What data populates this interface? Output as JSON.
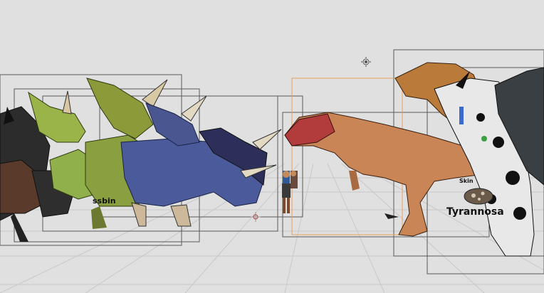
{
  "viewport": {
    "label_tyrannosaurus": "Tyrannosa",
    "label_skin": "Skin",
    "label_cut_left": "ssbin"
  },
  "colors": {
    "background": "#e0e0e0",
    "grid": "#c8c8c8",
    "bbox": "#5a5a5a",
    "selected_bbox": "#e8a060",
    "tyrannosaurus_body": "#c98556",
    "tyrannosaurus_head": "#b23b3b",
    "triceratops_blue": "#4b5a9a",
    "triceratops_green": "#8a9f40",
    "dark_dino": "#2c2c2c",
    "spotted_dino": "#e8e8e8"
  },
  "icons": [
    "cursor-crosshair-icon",
    "light-object-icon"
  ]
}
